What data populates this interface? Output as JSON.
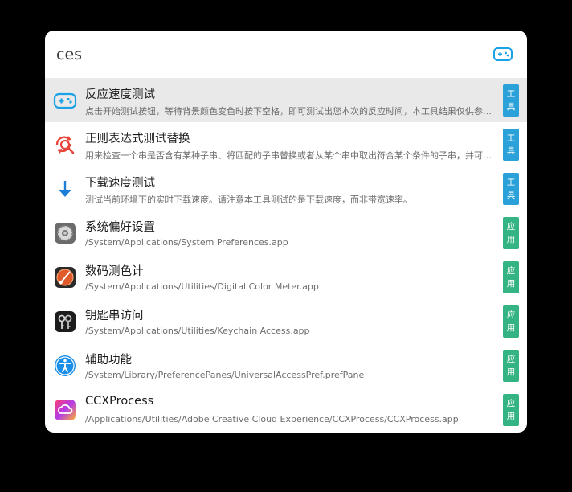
{
  "search": {
    "value": "ces",
    "logo_icon": "gamepad-icon"
  },
  "colors": {
    "accent_blue": "#1aa1e6",
    "tool_badge": "#2aa1d8",
    "app_badge": "#34b482",
    "selected_row": "#e9e9e9"
  },
  "results": [
    {
      "title": "反应速度测试",
      "desc": "点击开始测试按钮，等待背景颜色变色时按下空格，即可测试出您本次的反应时间，本工具结果仅供参考。",
      "badge_top": "工",
      "badge_bottom": "具",
      "icon": "gamepad-icon",
      "selected": true
    },
    {
      "title": "正则表达式测试替换",
      "desc": "用来检查一个串是否含有某种子串、将匹配的子串替换或者从某个串中取出符合某个条件的子串，并可替...",
      "badge_top": "工",
      "badge_bottom": "具",
      "icon": "regex-search-icon"
    },
    {
      "title": "下载速度测试",
      "desc": "测试当前环境下的实时下载速度。请注意本工具测试的是下载速度，而非带宽速率。",
      "badge_top": "工",
      "badge_bottom": "具",
      "icon": "download-arrow-icon"
    },
    {
      "title": "系统偏好设置",
      "desc": "/System/Applications/System Preferences.app",
      "badge_top": "应",
      "badge_bottom": "用",
      "icon": "system-preferences-icon"
    },
    {
      "title": "数码测色计",
      "desc": "/System/Applications/Utilities/Digital Color Meter.app",
      "badge_top": "应",
      "badge_bottom": "用",
      "icon": "color-meter-icon"
    },
    {
      "title": "钥匙串访问",
      "desc": "/System/Applications/Utilities/Keychain Access.app",
      "badge_top": "应",
      "badge_bottom": "用",
      "icon": "keychain-icon"
    },
    {
      "title": "辅助功能",
      "desc": "/System/Library/PreferencePanes/UniversalAccessPref.prefPane",
      "badge_top": "应",
      "badge_bottom": "用",
      "icon": "accessibility-icon"
    },
    {
      "title": "CCXProcess",
      "desc": "/Applications/Utilities/Adobe Creative Cloud Experience/CCXProcess/CCXProcess.app",
      "badge_top": "应",
      "badge_bottom": "用",
      "icon": "creative-cloud-icon"
    }
  ]
}
